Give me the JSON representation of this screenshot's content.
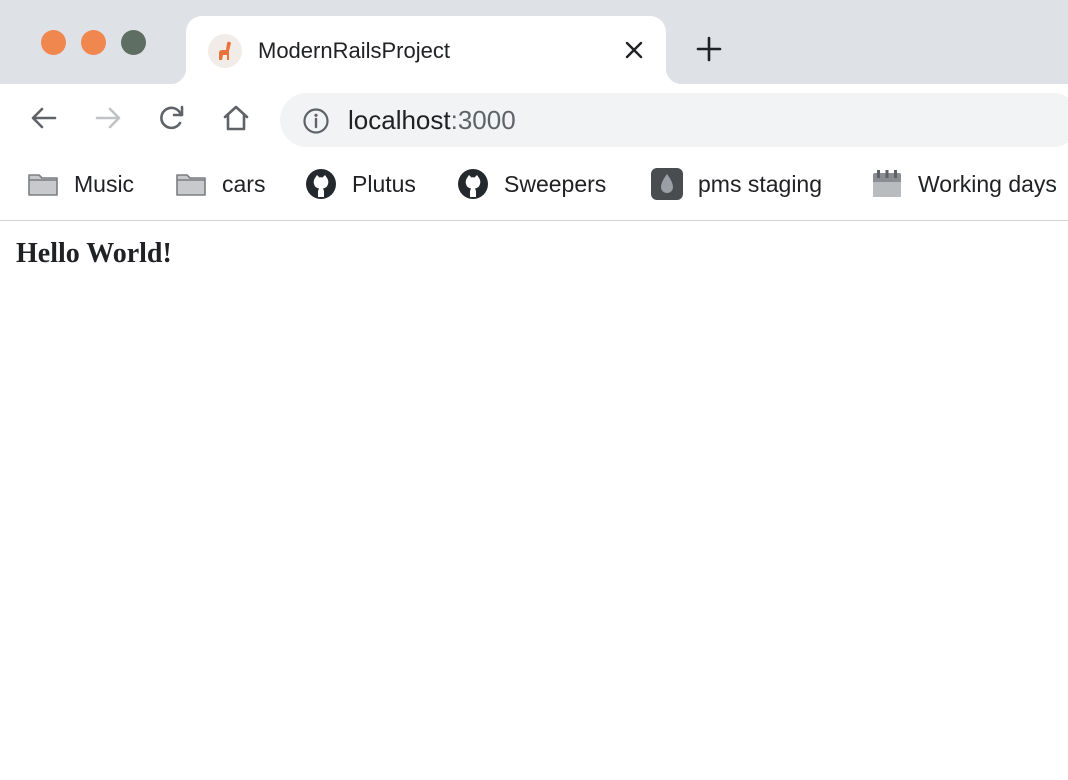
{
  "window": {
    "traffic_lights": {
      "close": "#f0874f",
      "minimize": "#f0874f",
      "maximize": "#5e6e63"
    }
  },
  "tab": {
    "title": "ModernRailsProject",
    "favicon": "rails-logo-icon"
  },
  "toolbar": {
    "back_icon": "arrow-left-icon",
    "forward_icon": "arrow-right-icon",
    "reload_icon": "reload-icon",
    "home_icon": "home-icon"
  },
  "address_bar": {
    "host": "localhost",
    "port": ":3000",
    "info_icon": "info-icon"
  },
  "bookmarks": [
    {
      "label": "Music",
      "icon": "folder-icon"
    },
    {
      "label": "cars",
      "icon": "folder-icon"
    },
    {
      "label": "Plutus",
      "icon": "github-icon"
    },
    {
      "label": "Sweepers",
      "icon": "github-icon"
    },
    {
      "label": "pms staging",
      "icon": "drop-icon"
    },
    {
      "label": "Working days",
      "icon": "calendar-icon"
    }
  ],
  "page": {
    "heading": "Hello World!"
  }
}
